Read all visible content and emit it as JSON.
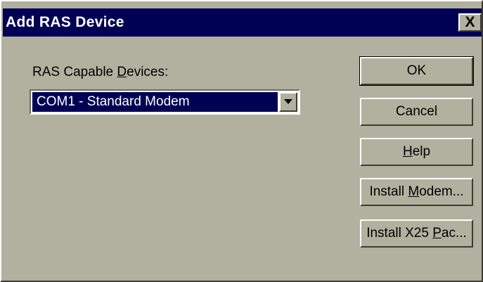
{
  "dialog": {
    "title": "Add RAS Device",
    "close_label": "X"
  },
  "devices": {
    "label_pre": "RAS Capable ",
    "label_access": "D",
    "label_post": "evices:",
    "selected": "COM1 - Standard Modem"
  },
  "buttons": {
    "ok": "OK",
    "cancel": "Cancel",
    "help_access": "H",
    "help_rest": "elp",
    "install_modem_pre": "Install ",
    "install_modem_access": "M",
    "install_modem_post": "odem...",
    "install_x25_pre": "Install X25 ",
    "install_x25_access": "P",
    "install_x25_post": "ac..."
  },
  "colors": {
    "dialog_bg": "#b2b09e",
    "title_bar": "#000055",
    "selection": "#000055"
  }
}
